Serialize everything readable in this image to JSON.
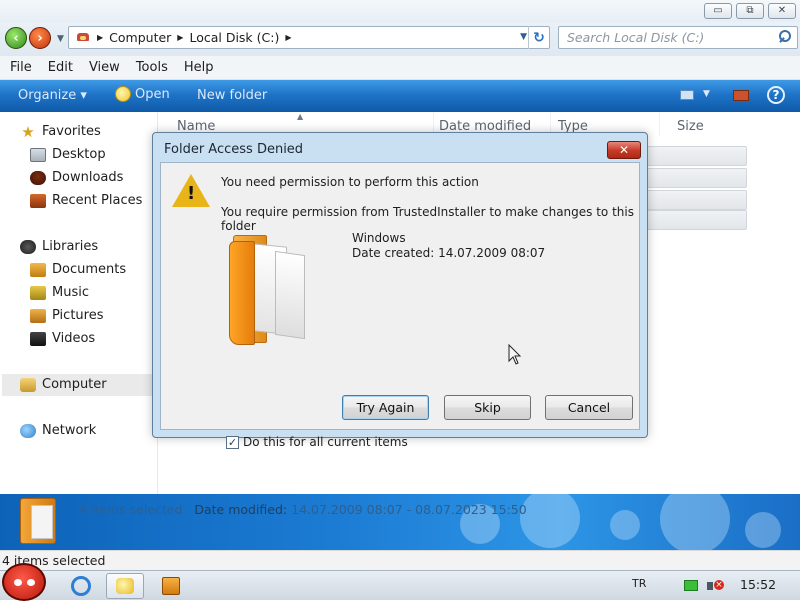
{
  "window": {
    "controls": {
      "minimize": "▭",
      "maximize": "⧉",
      "close": "✕"
    }
  },
  "address": {
    "crumbs": [
      "Computer",
      "Local Disk (C:)"
    ],
    "search_placeholder": "Search Local Disk (C:)"
  },
  "menu": [
    "File",
    "Edit",
    "View",
    "Tools",
    "Help"
  ],
  "commands": {
    "organize": "Organize ▾",
    "open": "Open",
    "new_folder": "New folder"
  },
  "nav": {
    "favorites": "Favorites",
    "desktop": "Desktop",
    "downloads": "Downloads",
    "recent": "Recent Places",
    "libraries": "Libraries",
    "documents": "Documents",
    "music": "Music",
    "pictures": "Pictures",
    "videos": "Videos",
    "computer": "Computer",
    "network": "Network"
  },
  "columns": {
    "name": "Name",
    "date": "Date modified",
    "type": "Type",
    "size": "Size"
  },
  "details": {
    "count": "4 items selected",
    "date_label": "Date modified:",
    "date_value": "14.07.2009 08:07 - 08.07.2023 15:50"
  },
  "status": "4 items selected",
  "dialog": {
    "title": "Folder Access Denied",
    "close": "✕",
    "message": "You need permission to perform this action",
    "detail": "You require permission from TrustedInstaller to make changes to this folder",
    "item_name": "Windows",
    "item_date": "Date created: 14.07.2009 08:07",
    "buttons": {
      "try_again": "Try Again",
      "skip": "Skip",
      "cancel": "Cancel"
    },
    "checkbox_label": "Do this for all current items",
    "checkbox_checked": true
  },
  "tray": {
    "lang": "TR",
    "clock": "15:52"
  },
  "icons": {
    "favorites": "star-icon",
    "desktop": "desktop-icon",
    "downloads": "downloads-icon",
    "recent": "recent-places-icon",
    "libraries": "libraries-icon",
    "documents": "documents-icon",
    "music": "music-icon",
    "pictures": "pictures-icon",
    "videos": "videos-icon",
    "computer": "computer-icon",
    "network": "network-icon",
    "warning": "warning-icon"
  },
  "colors": {
    "accent": "#1f74c8",
    "close_red": "#c33a26",
    "warning": "#e8b418"
  }
}
